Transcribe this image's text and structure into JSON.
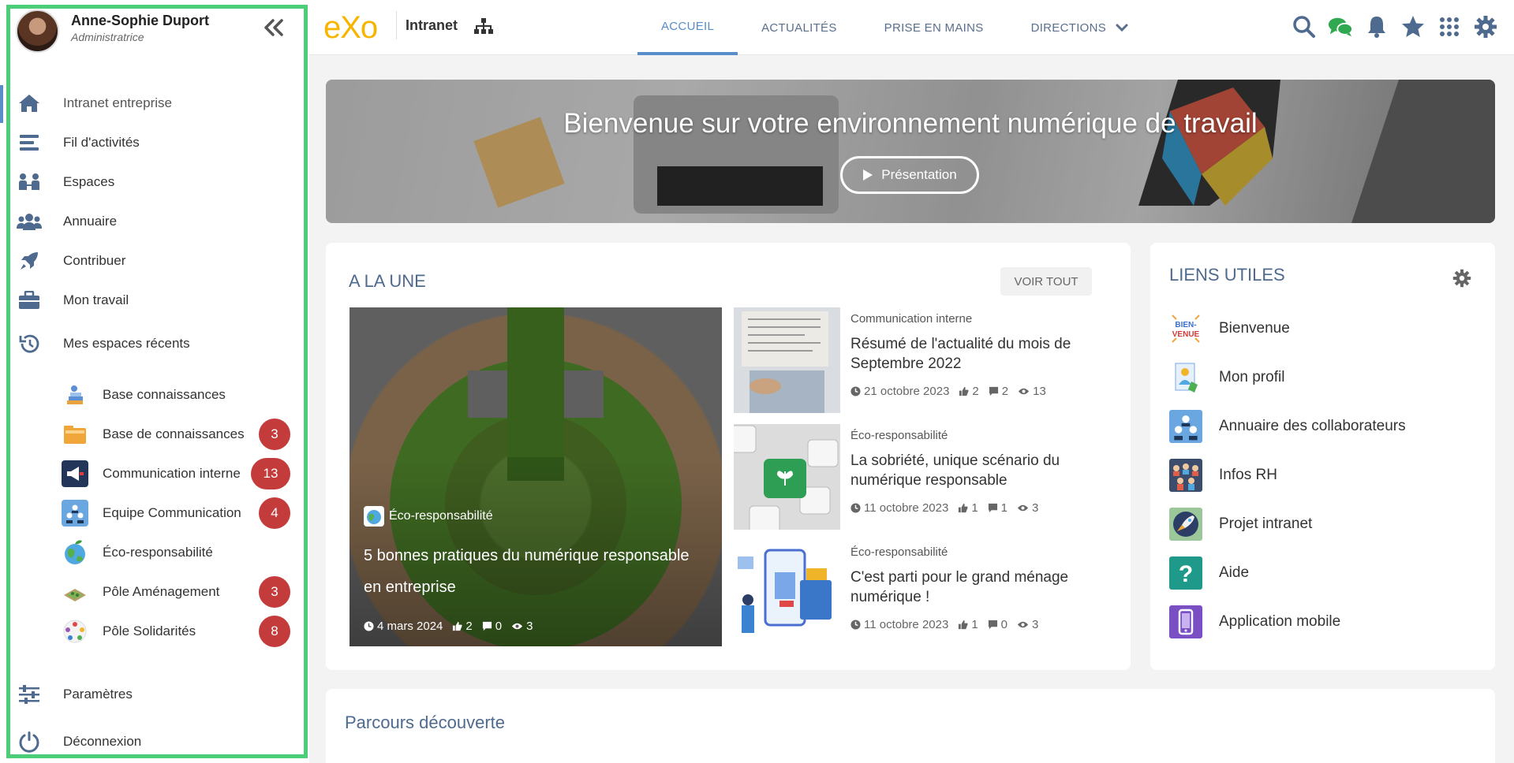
{
  "user": {
    "name": "Anne-Sophie Duport",
    "role": "Administratrice"
  },
  "sidebar": {
    "nav": [
      {
        "label": "Intranet entreprise",
        "icon": "home-icon"
      },
      {
        "label": "Fil d'activités",
        "icon": "stream-icon"
      },
      {
        "label": "Espaces",
        "icon": "spaces-icon"
      },
      {
        "label": "Annuaire",
        "icon": "people-icon"
      },
      {
        "label": "Contribuer",
        "icon": "rocket-icon"
      },
      {
        "label": "Mon travail",
        "icon": "briefcase-icon"
      },
      {
        "label": "Mes espaces récents",
        "icon": "history-icon"
      }
    ],
    "spaces": [
      {
        "label": "Base connaissances",
        "badge": ""
      },
      {
        "label": "Base de connaissances",
        "badge": "3"
      },
      {
        "label": "Communication interne",
        "badge": "13"
      },
      {
        "label": "Equipe Communication",
        "badge": "4"
      },
      {
        "label": "Éco-responsabilité",
        "badge": ""
      },
      {
        "label": "Pôle Aménagement",
        "badge": "3"
      },
      {
        "label": "Pôle Solidarités",
        "badge": "8"
      }
    ],
    "bottom": [
      {
        "label": "Paramètres",
        "icon": "sliders-icon"
      },
      {
        "label": "Déconnexion",
        "icon": "power-icon"
      }
    ]
  },
  "topbar": {
    "logo": "eXo",
    "site_name": "Intranet",
    "tabs": [
      "ACCUEIL",
      "ACTUALITÉS",
      "PRISE EN MAINS",
      "DIRECTIONS"
    ]
  },
  "banner": {
    "title": "Bienvenue sur votre environnement numérique de travail",
    "button": "Présentation"
  },
  "news": {
    "title": "A LA UNE",
    "see_all": "VOIR TOUT",
    "featured": {
      "category": "Éco-responsabilité",
      "title": "5 bonnes pratiques du numérique responsable en entreprise",
      "date": "4 mars 2024",
      "likes": "2",
      "comments": "0",
      "views": "3"
    },
    "items": [
      {
        "category": "Communication interne",
        "title": "Résumé de l'actualité du mois de Septembre 2022",
        "date": "21 octobre 2023",
        "likes": "2",
        "comments": "2",
        "views": "13"
      },
      {
        "category": "Éco-responsabilité",
        "title": "La sobriété, unique scénario du numérique responsable",
        "date": "11 octobre 2023",
        "likes": "1",
        "comments": "1",
        "views": "3"
      },
      {
        "category": "Éco-responsabilité",
        "title": "C'est parti pour le grand ménage numérique !",
        "date": "11 octobre 2023",
        "likes": "1",
        "comments": "0",
        "views": "3"
      }
    ]
  },
  "links": {
    "title": "LIENS UTILES",
    "items": [
      "Bienvenue",
      "Mon profil",
      "Annuaire des collaborateurs",
      "Infos RH",
      "Projet intranet",
      "Aide",
      "Application mobile"
    ]
  },
  "parcours": {
    "title": "Parcours découverte"
  },
  "colors": {
    "accent": "#578dc9",
    "badge": "#c43b3b",
    "highlight": "#4ccd78",
    "logo": "#f7b500"
  }
}
